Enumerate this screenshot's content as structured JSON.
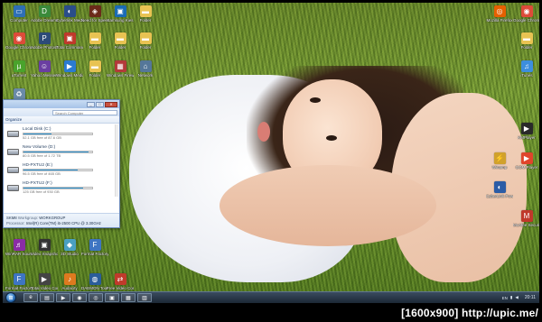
{
  "desktop": {
    "left_icons": [
      {
        "label": "Computer",
        "icon": "computer-icon",
        "color": "#2e6fb5"
      },
      {
        "label": "Adobe Dreamweaver",
        "icon": "dreamweaver-icon",
        "color": "#3a8a3a"
      },
      {
        "label": "Cyberlink Media Suite",
        "icon": "cyberlink-icon",
        "color": "#2a4d8a"
      },
      {
        "label": "Need for Speed",
        "icon": "game-icon",
        "color": "#6b2a1a"
      },
      {
        "label": "Samsung Kies",
        "icon": "app-icon",
        "color": "#1a6bb5"
      },
      {
        "label": "Folder",
        "icon": "folder-icon",
        "color": "#e8c352"
      },
      {
        "label": "Google Chrome",
        "icon": "chrome-icon",
        "color": "#dd4b39"
      },
      {
        "label": "Adobe Photoshop",
        "icon": "photoshop-icon",
        "color": "#2c4b78"
      },
      {
        "label": "Total Commander",
        "icon": "app-icon",
        "color": "#c0392b"
      },
      {
        "label": "Folder",
        "icon": "folder-icon",
        "color": "#e8c352"
      },
      {
        "label": "Folder",
        "icon": "folder-icon",
        "color": "#e8c352"
      },
      {
        "label": "Folder",
        "icon": "folder-icon",
        "color": "#e8c352"
      },
      {
        "label": "uTorrent",
        "icon": "torrent-icon",
        "color": "#4aa32c"
      },
      {
        "label": "Yahoo Messenger",
        "icon": "messenger-icon",
        "color": "#6a3ea1"
      },
      {
        "label": "Windows Media",
        "icon": "media-icon",
        "color": "#2b7bd1"
      },
      {
        "label": "Folder",
        "icon": "folder-icon",
        "color": "#e8c352"
      },
      {
        "label": "Windows Firewall",
        "icon": "firewall-icon",
        "color": "#b33a3a"
      },
      {
        "label": "Network",
        "icon": "network-icon",
        "color": "#557799"
      },
      {
        "label": "Recycle Bin",
        "icon": "recycle-bin-icon",
        "color": "#6a8aa8"
      },
      {
        "label": "Format Factory",
        "icon": "format-factory-icon",
        "color": "#3e75c2"
      },
      {
        "label": "Total Video Converter",
        "icon": "video-icon",
        "color": "#444"
      },
      {
        "label": "Audacity",
        "icon": "audacity-icon",
        "color": "#dd7a1f"
      },
      {
        "label": "DAEMON Tools Lite",
        "icon": "daemon-tools-icon",
        "color": "#2a5d9a"
      },
      {
        "label": "WinRAR Sound Editor",
        "icon": "sound-editor-icon",
        "color": "#8a2ca6"
      },
      {
        "label": "Video Snapshots",
        "icon": "snapshot-icon",
        "color": "#333"
      },
      {
        "label": "3D Studio",
        "icon": "3d-icon",
        "color": "#4aa0c2"
      },
      {
        "label": "Format Factory",
        "icon": "format-factory-icon",
        "color": "#3e75c2"
      },
      {
        "label": "Free Video Converter",
        "icon": "converter-icon",
        "color": "#c03a2b"
      }
    ],
    "right_icons": [
      {
        "label": "Mozilla Firefox",
        "icon": "firefox-icon",
        "color": "#e66000"
      },
      {
        "label": "Google Chrome",
        "icon": "chrome-icon",
        "color": "#dd4b39"
      },
      {
        "label": "Folder",
        "icon": "folder-icon",
        "color": "#e8c352"
      },
      {
        "label": "iTunes",
        "icon": "itunes-icon",
        "color": "#3d8ede"
      },
      {
        "label": "KMPlayer",
        "icon": "kmplayer-icon",
        "color": "#2a2a2a"
      },
      {
        "label": "Winamp",
        "icon": "winamp-icon",
        "color": "#d1a12b"
      },
      {
        "label": "GOM Player",
        "icon": "gom-player-icon",
        "color": "#e0452b"
      },
      {
        "label": "CyberLink PowerDVD",
        "icon": "powerdvd-icon",
        "color": "#2b5ca6"
      },
      {
        "label": "McAfee Security",
        "icon": "mcafee-icon",
        "color": "#c0392b"
      }
    ]
  },
  "explorer": {
    "search_placeholder": "Search Computer",
    "toolbar_label": "Organize",
    "drives": [
      {
        "name": "Local Disk (C:)",
        "free": "52.1 GB free of 87.6 GB",
        "used_fraction": 0.41
      },
      {
        "name": "New Volume (D:)",
        "free": "80.5 GB free of 1.72 TB",
        "used_fraction": 0.95
      },
      {
        "name": "HD-PXTU2 (E:)",
        "free": "96.5 GB free of 465 GB",
        "used_fraction": 0.79
      },
      {
        "name": "HD-PXTU2 (F:)",
        "free": "125 GB free of 930 GB",
        "used_fraction": 0.87
      }
    ],
    "details": {
      "machine": "SKM8",
      "workgroup_key": "Workgroup:",
      "workgroup": "WORKGROUP",
      "processor_key": "Processor:",
      "processor": "Intel(R) Core(TM) i5-2500 CPU @ 3.30GHz"
    }
  },
  "taskbar": {
    "start_icon": "windows-start-icon",
    "pinned": [
      {
        "name": "ie-icon",
        "glyph": "e"
      },
      {
        "name": "explorer-icon",
        "glyph": "▤"
      },
      {
        "name": "media-player-icon",
        "glyph": "▶"
      },
      {
        "name": "chrome-icon",
        "glyph": "◉"
      },
      {
        "name": "firefox-icon",
        "glyph": "◎"
      },
      {
        "name": "app-icon",
        "glyph": "▣"
      },
      {
        "name": "app-icon",
        "glyph": "▦"
      },
      {
        "name": "app-icon",
        "glyph": "▥"
      }
    ],
    "language": "EN",
    "clock": "20:11"
  },
  "caption": "[1600x900] http://upic.me/",
  "colors": {
    "taskbar": "#1c2835",
    "drive_bar": "#1a7fc4",
    "window_border": "#6b8ab8"
  }
}
